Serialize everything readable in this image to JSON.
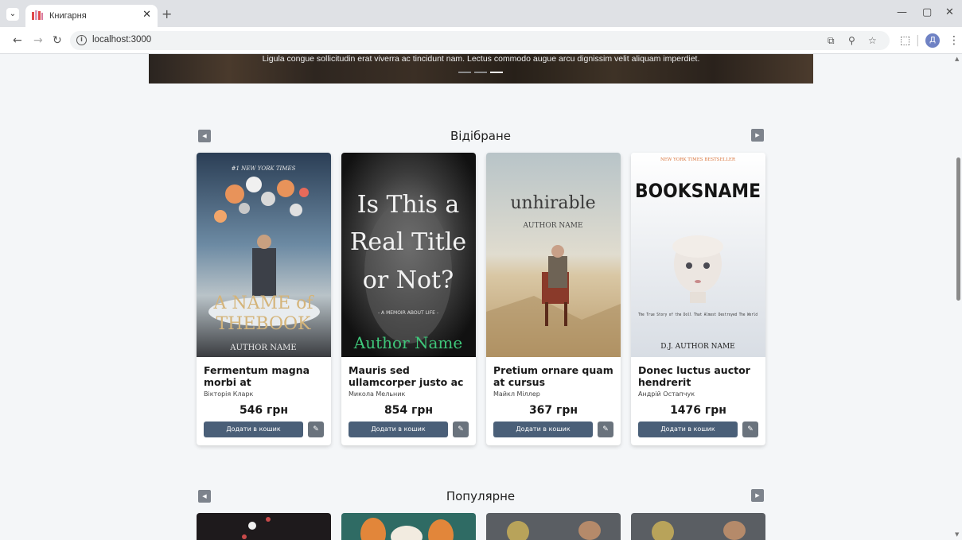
{
  "browser": {
    "tab_title": "Книгарня",
    "url": "localhost:3000",
    "avatar_letter": "Д"
  },
  "banner": {
    "text": "Ligula congue sollicitudin erat viverra ac tincidunt nam. Lectus commodo augue arcu dignissim velit aliquam imperdiet."
  },
  "featured": {
    "title": "Відібране",
    "books": [
      {
        "title": "Fermentum magna morbi at",
        "author": "Вікторія Кларк",
        "price": "546 грн",
        "add_label": "Додати в кошик",
        "cover": {
          "top_text": "#1 NEW YORK TIMES",
          "title_line1": "A NAME of",
          "title_line2": "THEBOOK",
          "author": "AUTHOR NAME"
        }
      },
      {
        "title": "Mauris sed ullamcorper justo ac",
        "author": "Микола Мельник",
        "price": "854 грн",
        "add_label": "Додати в кошик",
        "cover": {
          "title_line1": "Is This a",
          "title_line2": "Real Title",
          "title_line3": "or Not?",
          "subtitle": "- A MEMOIR ABOUT LIFE -",
          "author": "Author Name"
        }
      },
      {
        "title": "Pretium ornare quam at cursus",
        "author": "Майкл Міллер",
        "price": "367 грн",
        "add_label": "Додати в кошик",
        "cover": {
          "title": "unhirable",
          "author": "AUTHOR NAME"
        }
      },
      {
        "title": "Donec luctus auctor hendrerit",
        "author": "Андрій Остапчук",
        "price": "1476 грн",
        "add_label": "Додати в кошик",
        "cover": {
          "top_text": "NEW YORK TIMES BESTSELLER",
          "title": "BOOKSNAME",
          "tagline": "The True Story of the Doll That Almost Destroyed The World",
          "author": "D.J. AUTHOR NAME"
        }
      }
    ]
  },
  "popular": {
    "title": "Популярне"
  },
  "colors": {
    "primary_button": "#4a5f78",
    "edit_button": "#6a737d",
    "page_bg": "#f4f6f8"
  }
}
